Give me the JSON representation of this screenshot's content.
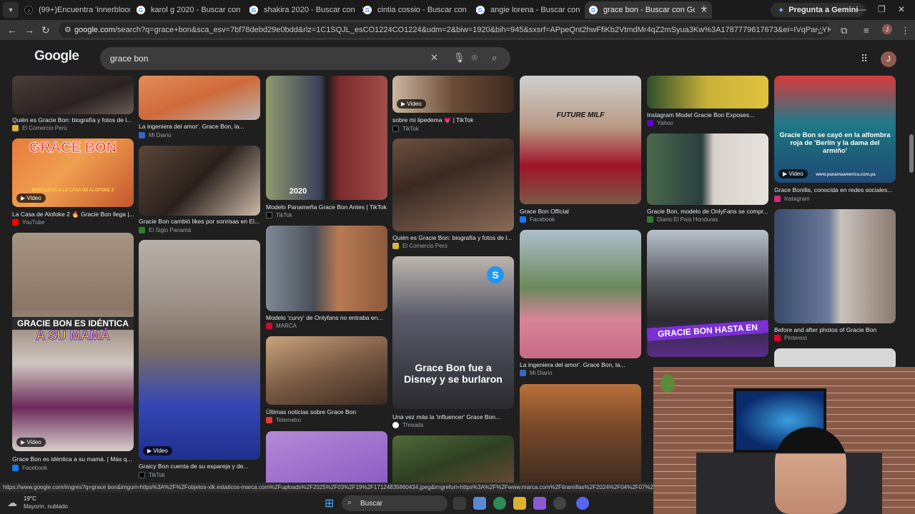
{
  "tabs": [
    {
      "label": "(99+)Encuentra 'innerbloom' en",
      "icon": "tiktok-icon",
      "active": false
    },
    {
      "label": "karol g 2020 - Buscar con Goog",
      "icon": "google-icon",
      "active": false
    },
    {
      "label": "shakira 2020 - Buscar con Goog",
      "icon": "google-icon",
      "active": false
    },
    {
      "label": "cintia cossio - Buscar con Goog",
      "icon": "google-icon",
      "active": false
    },
    {
      "label": "angie lorena - Buscar con Goog",
      "icon": "google-icon",
      "active": false
    },
    {
      "label": "grace bon - Buscar con Google",
      "icon": "google-icon",
      "active": true
    }
  ],
  "browser": {
    "gemini_label": "Pregunta a Gemini",
    "url_host": "google.com",
    "url_rest": "/search?q=grace+bon&sca_esv=7bf78debd29e0bdd&rlz=1C1SQJL_esCO1224CO1224&udm=2&biw=1920&bih=945&sxsrf=APpeQnt2hwFfiKb2VtmdMr4qZ2mSyua3Kw%3A1787779617673&ei=IVqPar_YKJqYwbkPu7ey8AY&ved=0ahUKE...",
    "profile_initial": "J"
  },
  "google": {
    "logo": "Google",
    "query": "grace bon",
    "avatar_initial": "J"
  },
  "results": {
    "video_label": "Video",
    "c1": [
      {
        "title": "Quién es Gracie Bon: biografía y fotos de l...",
        "source": "El Comercio Perú"
      },
      {
        "title": "La Casa de Alofoke 2 🔥 Gracie Bon llega |...",
        "source": "YouTube",
        "overlay": "GRACE BON",
        "subtext": "BON LLEGA A LA CASA DE ALOFOKE 2"
      },
      {
        "title": "Grace Bon es idéntica a su mamá. | Más q...",
        "source": "Facebook",
        "overlay1": "GRACIE BON ES IDÉNTICA",
        "overlay2": "A SU MAMÁ"
      }
    ],
    "c2": [
      {
        "title": "La ingeniera del amor'. Grace Bon, la...",
        "source": "Mi Diario"
      },
      {
        "title": "Gracie Bon cambió likes por sonrisas en El...",
        "source": "El Siglo Panamá"
      },
      {
        "title": "Graicy Bon cuenta de su expareja y de...",
        "source": "TikTok"
      }
    ],
    "c3": [
      {
        "title": "Modelo Panameña Grace Bon Antes | TikTok",
        "source": "TikTok",
        "overlay": "2020"
      },
      {
        "title": "Modelo 'curvy' de Onlyfans no entraba en...",
        "source": "MARCA"
      },
      {
        "title": "Últimas noticias sobre Grace Bon",
        "source": "Telemetro"
      }
    ],
    "c4": [
      {
        "title": "sobre mi lipedema 💗 | TikTok",
        "source": "TikTok"
      },
      {
        "title": "Quién es Gracie Bon: biografía y fotos de l...",
        "source": "El Comercio Perú"
      },
      {
        "title": "Una vez más la 'influencer' Grace Bon...",
        "source": "Threads",
        "overlay": "Grace Bon fue a Disney y se burlaron"
      }
    ],
    "c5": [
      {
        "title": "Grace Bon Official",
        "source": "Facebook",
        "shirt": "FUTURE MILF"
      },
      {
        "title": "La ingeniera del amor'. Grace Bon, la...",
        "source": "Mi Diario"
      }
    ],
    "c6": [
      {
        "title": "Instagram Model Gracie Bon Exposes...",
        "source": "Yahoo"
      },
      {
        "title": "Gracie Bon, modelo de OnlyFans se compr...",
        "source": "Diario El País Honduras"
      },
      {
        "overlay": "GRACIE BON HASTA EN"
      }
    ],
    "c7": [
      {
        "title": "Grace Bonilla, conocida en redes sociales...",
        "source": "Instagram",
        "overlay": "Gracie Bon se cayó en la alfombra roja de 'Berlín y la dama del armiño'",
        "watermark": "www.panamaamerica.com.pa"
      },
      {
        "title": "Before and after photos of Gracie Bon",
        "source": "Pinterest"
      }
    ]
  },
  "status_url": "https://www.google.com/imgres?q=grace bon&imgurl=https%3A%2F%2Fobjetos-xlk.estaticos-marca.com%2Fuploads%2F2025%2F03%2F19%2F17124835860434.jpeg&imgrefurl=https%3A%2F%2Fwww.marca.com%2Ftiramillas%2F2024%2F04%2F07%2F6612",
  "taskbar": {
    "temp": "19°C",
    "weather": "Mayorm. nublado",
    "search_label": "Buscar"
  },
  "colors": {
    "page_bg": "#1f1f1f",
    "toolbar_bg": "#353535",
    "search_bg": "#3c3c3c",
    "accent_link": "#8ab4f8"
  }
}
